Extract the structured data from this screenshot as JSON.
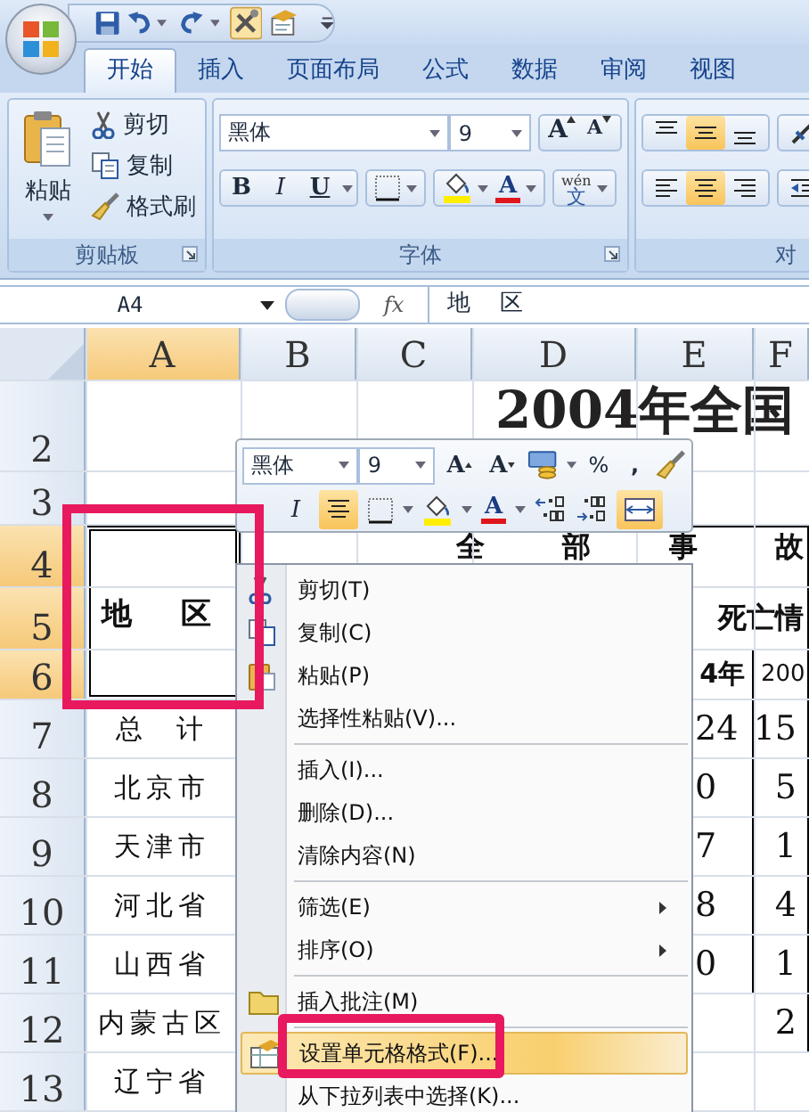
{
  "ribbon": {
    "tabs": [
      {
        "label": "开始",
        "selected": true
      },
      {
        "label": "插入",
        "selected": false
      },
      {
        "label": "页面布局",
        "selected": false
      },
      {
        "label": "公式",
        "selected": false
      },
      {
        "label": "数据",
        "selected": false
      },
      {
        "label": "审阅",
        "selected": false
      },
      {
        "label": "视图",
        "selected": false
      }
    ],
    "clipboard": {
      "paste": "粘贴",
      "items": [
        {
          "label": "剪切"
        },
        {
          "label": "复制"
        },
        {
          "label": "格式刷"
        }
      ],
      "label": "剪贴板"
    },
    "font": {
      "font_name": "黑体",
      "font_size": "9",
      "grow": "A",
      "shrink": "A",
      "bold": "B",
      "italic": "I",
      "underline": "U",
      "font_color": "A",
      "phonetic_ruby": "wén",
      "phonetic_char": "文",
      "label": "字体"
    },
    "alignment": {
      "vertical": [
        {
          "kind": "top",
          "selected": false
        },
        {
          "kind": "middle",
          "selected": true
        },
        {
          "kind": "bottom",
          "selected": false
        }
      ],
      "horizontal": [
        {
          "kind": "left",
          "selected": false
        },
        {
          "kind": "center",
          "selected": true
        },
        {
          "kind": "right",
          "selected": false
        }
      ],
      "label": "对"
    }
  },
  "formula_bar": {
    "name_box": "A4",
    "fx": "fx",
    "formula": "地    区"
  },
  "sheet": {
    "columns": [
      {
        "label": "A",
        "selected": true
      },
      {
        "label": "B",
        "selected": false
      },
      {
        "label": "C",
        "selected": false
      },
      {
        "label": "D",
        "selected": false
      },
      {
        "label": "E",
        "selected": false
      },
      {
        "label": "F",
        "selected": false
      }
    ],
    "rows": [
      {
        "label": "2",
        "selected": false
      },
      {
        "label": "3",
        "selected": false
      },
      {
        "label": "4",
        "selected": true
      },
      {
        "label": "5",
        "selected": true
      },
      {
        "label": "6",
        "selected": true
      },
      {
        "label": "7",
        "selected": false
      },
      {
        "label": "8",
        "selected": false
      },
      {
        "label": "9",
        "selected": false
      },
      {
        "label": "10",
        "selected": false
      },
      {
        "label": "11",
        "selected": false
      },
      {
        "label": "12",
        "selected": false
      },
      {
        "label": "13",
        "selected": false
      }
    ],
    "title": "2004年全国",
    "region_header": "地    区",
    "group_header": "全   部   事   故",
    "subgroup_header": "死亡情",
    "year_cells": [
      "4年",
      "200"
    ],
    "region_names": [
      "总  计",
      "北京市",
      "天津市",
      "河北省",
      "山西省",
      "内蒙古区",
      "辽宁省"
    ],
    "values_e": [
      "24",
      "0",
      "7",
      "8",
      "0"
    ],
    "values_f": [
      "15",
      "5",
      "1",
      "4",
      "1",
      "2"
    ]
  },
  "mini_toolbar": {
    "font_name": "黑体",
    "font_size": "9",
    "grow": "A",
    "shrink": "A",
    "percent": "%",
    "comma": ",",
    "italic": "I",
    "align_center": {
      "selected": true
    },
    "font_color": "A",
    "merge": {
      "selected": true
    }
  },
  "context_menu": [
    {
      "kind": "item",
      "label": "剪切(T)",
      "submenu": false,
      "selected": false
    },
    {
      "kind": "item",
      "label": "复制(C)",
      "submenu": false,
      "selected": false
    },
    {
      "kind": "item",
      "label": "粘贴(P)",
      "submenu": false,
      "selected": false
    },
    {
      "kind": "item",
      "label": "选择性粘贴(V)...",
      "submenu": false,
      "selected": false
    },
    {
      "kind": "separator"
    },
    {
      "kind": "item",
      "label": "插入(I)...",
      "submenu": false,
      "selected": false
    },
    {
      "kind": "item",
      "label": "删除(D)...",
      "submenu": false,
      "selected": false
    },
    {
      "kind": "item",
      "label": "清除内容(N)",
      "submenu": false,
      "selected": false
    },
    {
      "kind": "separator"
    },
    {
      "kind": "item",
      "label": "筛选(E)",
      "submenu": true,
      "selected": false
    },
    {
      "kind": "item",
      "label": "排序(O)",
      "submenu": true,
      "selected": false
    },
    {
      "kind": "separator"
    },
    {
      "kind": "item",
      "label": "插入批注(M)",
      "submenu": false,
      "selected": false
    },
    {
      "kind": "separator"
    },
    {
      "kind": "item",
      "label": "设置单元格格式(F)...",
      "submenu": false,
      "selected": true
    },
    {
      "kind": "item",
      "label": "从下拉列表中选择(K)...",
      "submenu": false,
      "selected": false
    }
  ]
}
